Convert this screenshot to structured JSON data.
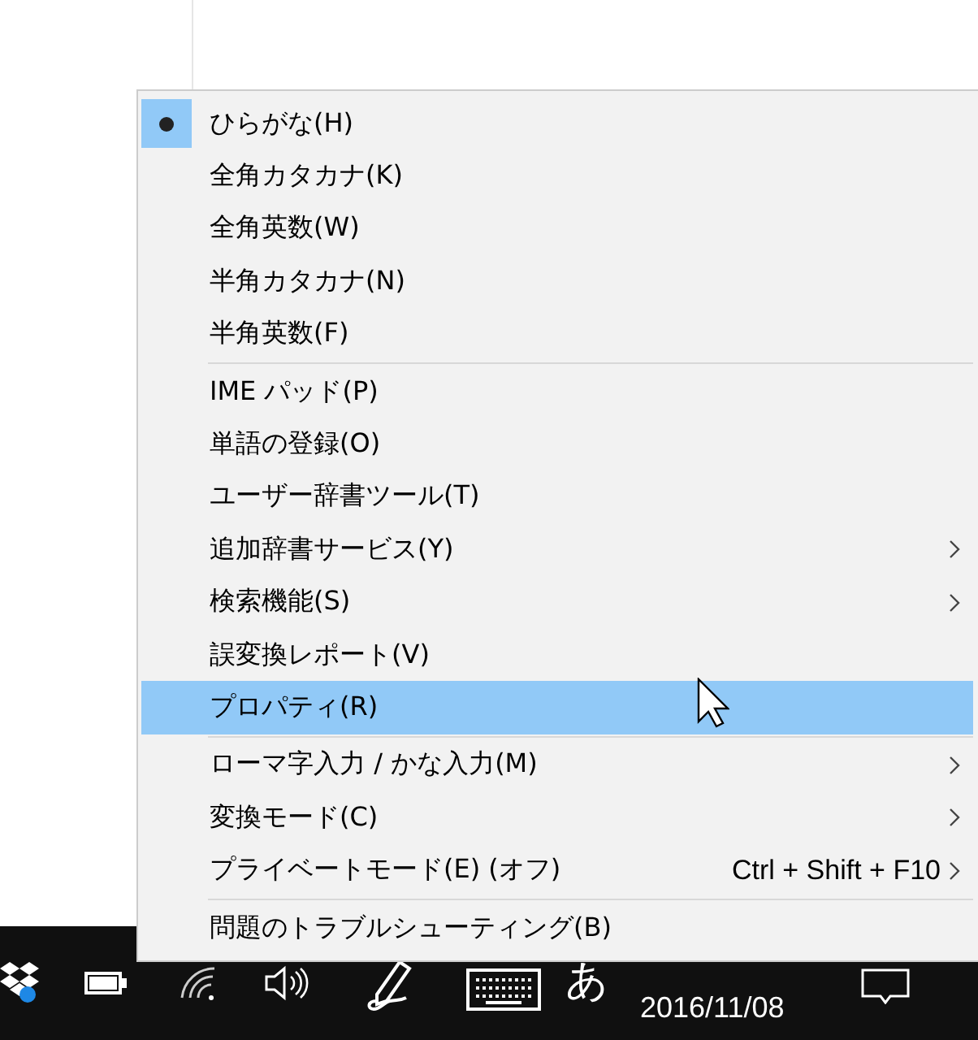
{
  "menu": {
    "groups": [
      [
        {
          "label": "ひらがな(H)",
          "checked": true,
          "selected": false,
          "submenu": false
        },
        {
          "label": "全角カタカナ(K)",
          "checked": false,
          "selected": false,
          "submenu": false
        },
        {
          "label": "全角英数(W)",
          "checked": false,
          "selected": false,
          "submenu": false
        },
        {
          "label": "半角カタカナ(N)",
          "checked": false,
          "selected": false,
          "submenu": false
        },
        {
          "label": "半角英数(F)",
          "checked": false,
          "selected": false,
          "submenu": false
        }
      ],
      [
        {
          "label": "IME パッド(P)",
          "checked": false,
          "selected": false,
          "submenu": false
        },
        {
          "label": "単語の登録(O)",
          "checked": false,
          "selected": false,
          "submenu": false
        },
        {
          "label": "ユーザー辞書ツール(T)",
          "checked": false,
          "selected": false,
          "submenu": false
        },
        {
          "label": "追加辞書サービス(Y)",
          "checked": false,
          "selected": false,
          "submenu": true
        },
        {
          "label": "検索機能(S)",
          "checked": false,
          "selected": false,
          "submenu": true
        },
        {
          "label": "誤変換レポート(V)",
          "checked": false,
          "selected": false,
          "submenu": false
        },
        {
          "label": "プロパティ(R)",
          "checked": false,
          "selected": true,
          "submenu": false
        }
      ],
      [
        {
          "label": "ローマ字入力 / かな入力(M)",
          "checked": false,
          "selected": false,
          "submenu": true
        },
        {
          "label": "変換モード(C)",
          "checked": false,
          "selected": false,
          "submenu": true
        },
        {
          "label": "プライベートモード(E) (オフ)",
          "shortcut": "Ctrl + Shift + F10",
          "checked": false,
          "selected": false,
          "submenu": true
        }
      ],
      [
        {
          "label": "問題のトラブルシューティング(B)",
          "checked": false,
          "selected": false,
          "submenu": false
        }
      ]
    ]
  },
  "taskbar": {
    "ime_mode": "あ",
    "date": "2016/11/08"
  }
}
